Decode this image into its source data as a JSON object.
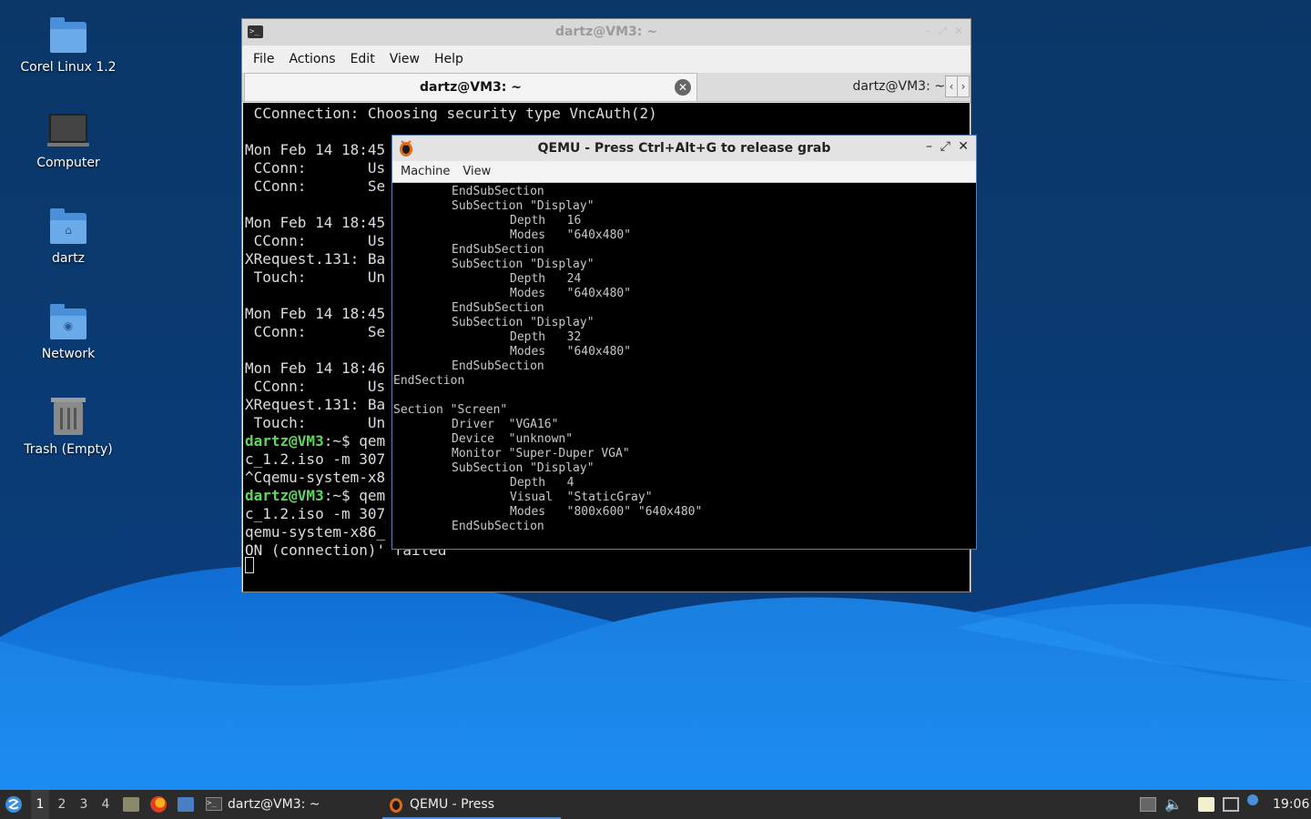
{
  "desktop": {
    "icons": [
      {
        "label": "Corel Linux 1.2",
        "icon": "folder-icon"
      },
      {
        "label": "Computer",
        "icon": "computer-icon"
      },
      {
        "label": "dartz",
        "icon": "home-folder-icon"
      },
      {
        "label": "Network",
        "icon": "network-folder-icon"
      },
      {
        "label": "Trash (Empty)",
        "icon": "trash-icon"
      }
    ]
  },
  "terminal": {
    "title": "dartz@VM3: ~",
    "menu": [
      "File",
      "Actions",
      "Edit",
      "View",
      "Help"
    ],
    "tabs": [
      {
        "label": "dartz@VM3: ~",
        "active": true
      },
      {
        "label": "dartz@VM3: ~",
        "active": false
      }
    ],
    "lines": [
      {
        "text": " CConnection: Choosing security type VncAuth(2)"
      },
      {
        "text": ""
      },
      {
        "text": "Mon Feb 14 18:45"
      },
      {
        "text": " CConn:       Us"
      },
      {
        "text": " CConn:       Se"
      },
      {
        "text": ""
      },
      {
        "text": "Mon Feb 14 18:45"
      },
      {
        "text": " CConn:       Us"
      },
      {
        "text": "XRequest.131: Ba"
      },
      {
        "text": " Touch:       Un"
      },
      {
        "text": ""
      },
      {
        "text": "Mon Feb 14 18:45"
      },
      {
        "text": " CConn:       Se"
      },
      {
        "text": ""
      },
      {
        "text": "Mon Feb 14 18:46"
      },
      {
        "text": " CConn:       Us"
      },
      {
        "text": "XRequest.131: Ba"
      },
      {
        "text": " Touch:       Un"
      },
      {
        "prompt": "dartz@VM3",
        "rest": ":~$ qem"
      },
      {
        "text": "c_1.2.iso -m 307"
      },
      {
        "text": "^Cqemu-system-x8"
      },
      {
        "prompt": "dartz@VM3",
        "rest": ":~$ qem"
      },
      {
        "text": "c_1.2.iso -m 307"
      },
      {
        "text": "qemu-system-x86_"
      },
      {
        "text": "ON (connection)' failed"
      }
    ]
  },
  "qemu": {
    "title": "QEMU - Press Ctrl+Alt+G to release grab",
    "menu": [
      "Machine",
      "View"
    ],
    "lines": [
      {
        "indent": 64,
        "text": "EndSubSection"
      },
      {
        "indent": 64,
        "text": "SubSection \"Display\""
      },
      {
        "indent": 128,
        "text": "Depth   16"
      },
      {
        "indent": 128,
        "text": "Modes   \"640x480\""
      },
      {
        "indent": 64,
        "text": "EndSubSection"
      },
      {
        "indent": 64,
        "text": "SubSection \"Display\""
      },
      {
        "indent": 128,
        "text": "Depth   24"
      },
      {
        "indent": 128,
        "text": "Modes   \"640x480\""
      },
      {
        "indent": 64,
        "text": "EndSubSection"
      },
      {
        "indent": 64,
        "text": "SubSection \"Display\""
      },
      {
        "indent": 128,
        "text": "Depth   32"
      },
      {
        "indent": 128,
        "text": "Modes   \"640x480\""
      },
      {
        "indent": 64,
        "text": "EndSubSection"
      },
      {
        "indent": 0,
        "text": "EndSection"
      },
      {
        "indent": 0,
        "text": ""
      },
      {
        "indent": 0,
        "text": "Section \"Screen\""
      },
      {
        "indent": 64,
        "text": "Driver  \"VGA16\""
      },
      {
        "indent": 64,
        "text": "Device  \"unknown\""
      },
      {
        "indent": 64,
        "text": "Monitor \"Super-Duper VGA\""
      },
      {
        "indent": 64,
        "text": "SubSection \"Display\""
      },
      {
        "indent": 128,
        "text": "Depth   4"
      },
      {
        "indent": 128,
        "text": "Visual  \"StaticGray\""
      },
      {
        "indent": 128,
        "text": "Modes   \"800x600\" \"640x480\""
      },
      {
        "indent": 64,
        "text": "EndSubSection"
      }
    ]
  },
  "taskbar": {
    "workspaces": [
      "1",
      "2",
      "3",
      "4"
    ],
    "active_workspace": "1",
    "tasks": [
      {
        "label": "dartz@VM3: ~",
        "icon": "terminal-icon",
        "active": false
      },
      {
        "label": "QEMU - Press Ctrl+Alt...",
        "icon": "qemu-icon",
        "active": true
      }
    ],
    "clock": "19:06"
  },
  "colors": {
    "wallpaper_dark": "#0b3a73",
    "wave_light": "#1e8ff0",
    "prompt_green": "#5fd75f",
    "accent": "#4a90d9"
  }
}
